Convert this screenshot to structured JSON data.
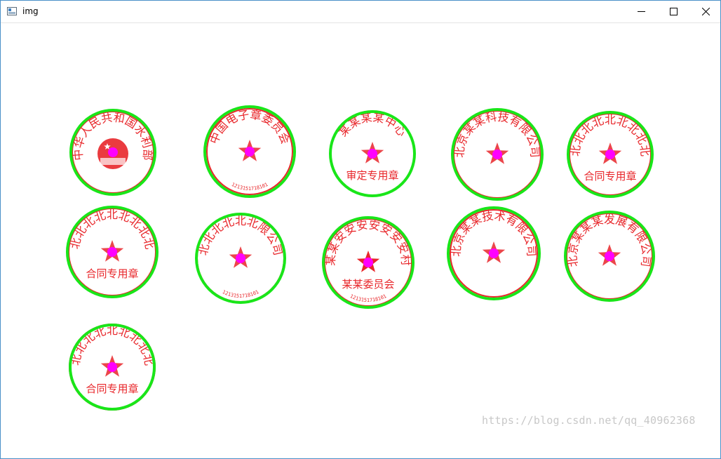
{
  "window": {
    "title": "img"
  },
  "watermark": "https://blog.csdn.net/qq_40962368",
  "colors": {
    "circle": "#19e619",
    "center": "#ff00ff",
    "seal_red": "#e8262a",
    "watermark": "#c8c8c8"
  },
  "seals": [
    {
      "text": "中华人民共和国水利部",
      "subtext": "",
      "serial": "",
      "emblem": "national-emblem"
    },
    {
      "text": "中国电子章委员会",
      "subtext": "",
      "serial": "1213151718101",
      "emblem": "star"
    },
    {
      "text": "某某某某中心",
      "subtext": "审定专用章",
      "serial": "",
      "emblem": "star"
    },
    {
      "text": "北京某某科技有限公司",
      "subtext": "",
      "serial": "",
      "emblem": "star"
    },
    {
      "text": "北北北北北北北北北",
      "subtext": "合同专用章",
      "serial": "",
      "emblem": "star"
    },
    {
      "text": "北北北北北北北北北",
      "subtext": "合同专用章",
      "serial": "",
      "emblem": "star"
    },
    {
      "text": "北北北北北北限公司",
      "subtext": "",
      "serial": "1213151718101",
      "emblem": "star"
    },
    {
      "text": "某某安安安安安安安村",
      "subtext": "某某委员会",
      "serial": "1213151718101",
      "emblem": "star"
    },
    {
      "text": "北京某某技术有限公司",
      "subtext": "",
      "serial": "",
      "emblem": "star"
    },
    {
      "text": "北京某某某发展有限公司",
      "subtext": "",
      "serial": "",
      "emblem": "star"
    },
    {
      "text": "北北北北北北北北北",
      "subtext": "合同专用章",
      "serial": "",
      "emblem": "star"
    }
  ]
}
